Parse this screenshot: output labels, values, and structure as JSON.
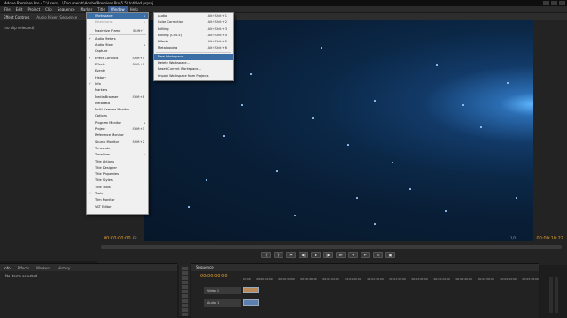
{
  "titlebar": {
    "title": "Adobe Premiere Pro - C:\\Users\\...\\Documents\\Adobe\\Premiere Pro\\5.5\\Untitled.prproj"
  },
  "menubar": {
    "items": [
      "File",
      "Edit",
      "Project",
      "Clip",
      "Sequence",
      "Marker",
      "Title",
      "Window",
      "Help"
    ],
    "active": "Window"
  },
  "left_panel": {
    "tabs": [
      "Effect Controls",
      "Audio Mixer: Sequence"
    ],
    "no_clip": "(no clip selected)"
  },
  "window_menu": {
    "items": [
      {
        "label": "Workspace",
        "shortcut": "",
        "check": "",
        "sub": "▸",
        "highlight": true
      },
      {
        "label": "Extensions",
        "shortcut": "",
        "check": "",
        "sub": "▸",
        "disabled": true
      },
      {
        "sep": true
      },
      {
        "label": "Maximize Frame",
        "shortcut": "Shift+`",
        "check": ""
      },
      {
        "sep": true
      },
      {
        "label": "Audio Meters",
        "shortcut": "",
        "check": "✓"
      },
      {
        "label": "Audio Mixer",
        "shortcut": "",
        "check": "",
        "sub": "▸"
      },
      {
        "label": "Capture",
        "shortcut": "",
        "check": ""
      },
      {
        "label": "Effect Controls",
        "shortcut": "Shift+5",
        "check": "✓"
      },
      {
        "label": "Effects",
        "shortcut": "Shift+7",
        "check": ""
      },
      {
        "label": "Events",
        "shortcut": "",
        "check": ""
      },
      {
        "label": "History",
        "shortcut": "",
        "check": ""
      },
      {
        "label": "Info",
        "shortcut": "",
        "check": "✓"
      },
      {
        "label": "Markers",
        "shortcut": "",
        "check": ""
      },
      {
        "label": "Media Browser",
        "shortcut": "Shift+8",
        "check": ""
      },
      {
        "label": "Metadata",
        "shortcut": "",
        "check": ""
      },
      {
        "label": "Multi-Camera Monitor",
        "shortcut": "",
        "check": ""
      },
      {
        "label": "Options",
        "shortcut": "",
        "check": ""
      },
      {
        "label": "Program Monitor",
        "shortcut": "",
        "check": "",
        "sub": "▸"
      },
      {
        "label": "Project",
        "shortcut": "Shift+1",
        "check": ""
      },
      {
        "label": "Reference Monitor",
        "shortcut": "",
        "check": ""
      },
      {
        "label": "Source Monitor",
        "shortcut": "Shift+2",
        "check": ""
      },
      {
        "label": "Timecode",
        "shortcut": "",
        "check": ""
      },
      {
        "label": "Timelines",
        "shortcut": "",
        "check": "",
        "sub": "▸"
      },
      {
        "label": "Title Actions",
        "shortcut": "",
        "check": ""
      },
      {
        "label": "Title Designer",
        "shortcut": "",
        "check": ""
      },
      {
        "label": "Title Properties",
        "shortcut": "",
        "check": ""
      },
      {
        "label": "Title Styles",
        "shortcut": "",
        "check": ""
      },
      {
        "label": "Title Tools",
        "shortcut": "",
        "check": ""
      },
      {
        "label": "Tools",
        "shortcut": "",
        "check": "✓"
      },
      {
        "label": "Trim Monitor",
        "shortcut": "",
        "check": ""
      },
      {
        "label": "VST Editor",
        "shortcut": "",
        "check": ""
      }
    ]
  },
  "workspace_submenu": {
    "items": [
      {
        "label": "Audio",
        "shortcut": "Alt+Shift+1"
      },
      {
        "label": "Color Correction",
        "shortcut": "Alt+Shift+2"
      },
      {
        "label": "Editing",
        "shortcut": "Alt+Shift+3"
      },
      {
        "label": "Editing (CS5.5)",
        "shortcut": "Alt+Shift+4"
      },
      {
        "label": "Effects",
        "shortcut": "Alt+Shift+5"
      },
      {
        "label": "Metalogging",
        "shortcut": "Alt+Shift+6"
      },
      {
        "sep": true
      },
      {
        "label": "New Workspace...",
        "shortcut": "",
        "highlight": true
      },
      {
        "label": "Delete Workspace...",
        "shortcut": ""
      },
      {
        "label": "Reset Current Workspace...",
        "shortcut": ""
      },
      {
        "label": "Import Workspace from Projects",
        "shortcut": ""
      }
    ]
  },
  "monitor": {
    "timecode_in": "00:00:00:00",
    "timecode_out": "00:00:10:22",
    "fit": "Fit",
    "fraction": "1/2"
  },
  "transport": [
    "{",
    "}",
    "⏮",
    "◀|",
    "▶",
    "|▶",
    "⏭",
    "⇥",
    "⇤",
    "⟲",
    "▣"
  ],
  "bottom_left": {
    "tabs": [
      "Info",
      "Effects",
      "Markers",
      "History"
    ],
    "no_items": "No items selected"
  },
  "timeline": {
    "tab": "Sequence",
    "timecode": "00:00:00:00",
    "ruler": [
      "00:00",
      "00:00:16:00",
      "00:00:32:00",
      "00:00:48:00",
      "00:01:04:00",
      "00:01:20:00",
      "00:01:36:00",
      "00:01:52:00",
      "00:02:08:00",
      "00:02:24:00",
      "00:02:40:00",
      "00:02:56:00",
      "00:03:12:00",
      "00:03:28:00"
    ],
    "tracks": [
      {
        "name": "Video 1",
        "type": "video"
      },
      {
        "name": "Audio 1",
        "type": "audio"
      }
    ]
  }
}
